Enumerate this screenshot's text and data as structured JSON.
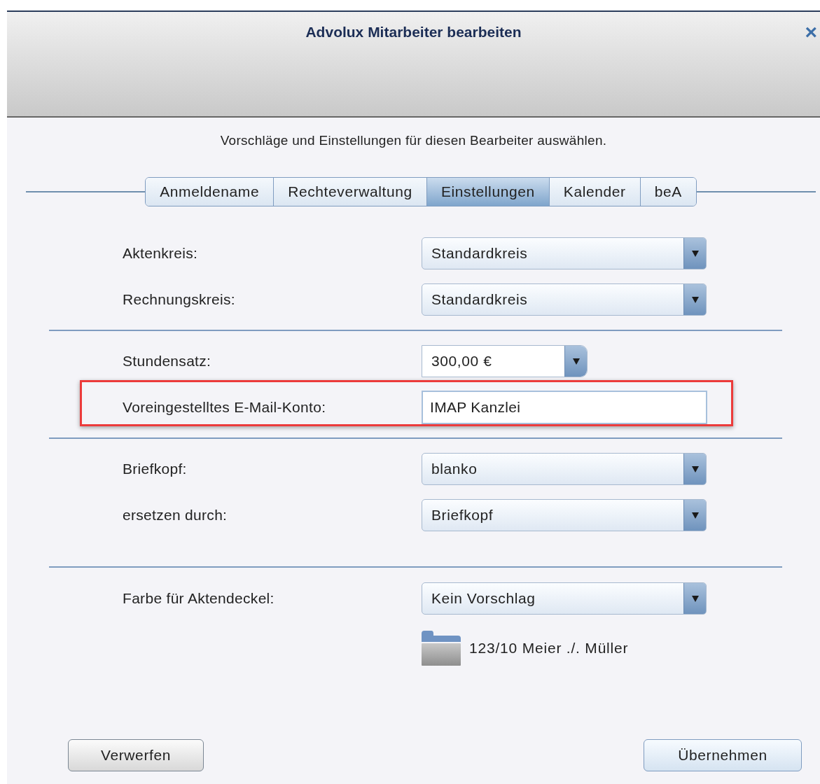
{
  "window": {
    "title": "Advolux Mitarbeiter bearbeiten",
    "close": "×"
  },
  "subtitle": "Vorschläge und Einstellungen für diesen Bearbeiter auswählen.",
  "tabs": [
    {
      "label": "Anmeldename",
      "selected": false
    },
    {
      "label": "Rechteverwaltung",
      "selected": false
    },
    {
      "label": "Einstellungen",
      "selected": true
    },
    {
      "label": "Kalender",
      "selected": false
    },
    {
      "label": "beA",
      "selected": false
    }
  ],
  "sections": [
    {
      "rows": [
        {
          "label": "Aktenkreis:",
          "kind": "select",
          "value": "Standardkreis",
          "highlighted": false
        },
        {
          "label": "Rechnungskreis:",
          "kind": "select",
          "value": "Standardkreis",
          "highlighted": false
        }
      ]
    },
    {
      "rows": [
        {
          "label": "Stundensatz:",
          "kind": "combo",
          "value": "300,00 €",
          "highlighted": false
        },
        {
          "label": "Voreingestelltes E-Mail-Konto:",
          "kind": "text",
          "value": "IMAP Kanzlei",
          "highlighted": true
        }
      ]
    },
    {
      "rows": [
        {
          "label": "Briefkopf:",
          "kind": "select",
          "value": "blanko",
          "highlighted": false
        },
        {
          "label": "ersetzen durch:",
          "kind": "select",
          "value": "Briefkopf",
          "highlighted": false
        }
      ]
    },
    {
      "rows": [
        {
          "label": "Farbe für Aktendeckel:",
          "kind": "select",
          "value": "Kein Vorschlag",
          "highlighted": false
        }
      ],
      "folder_preview": {
        "text": "123/10 Meier ./. Müller"
      }
    }
  ],
  "buttons": [
    {
      "label": "Verwerfen",
      "kind": "cancel"
    },
    {
      "label": "Übernehmen",
      "kind": "ok"
    }
  ]
}
